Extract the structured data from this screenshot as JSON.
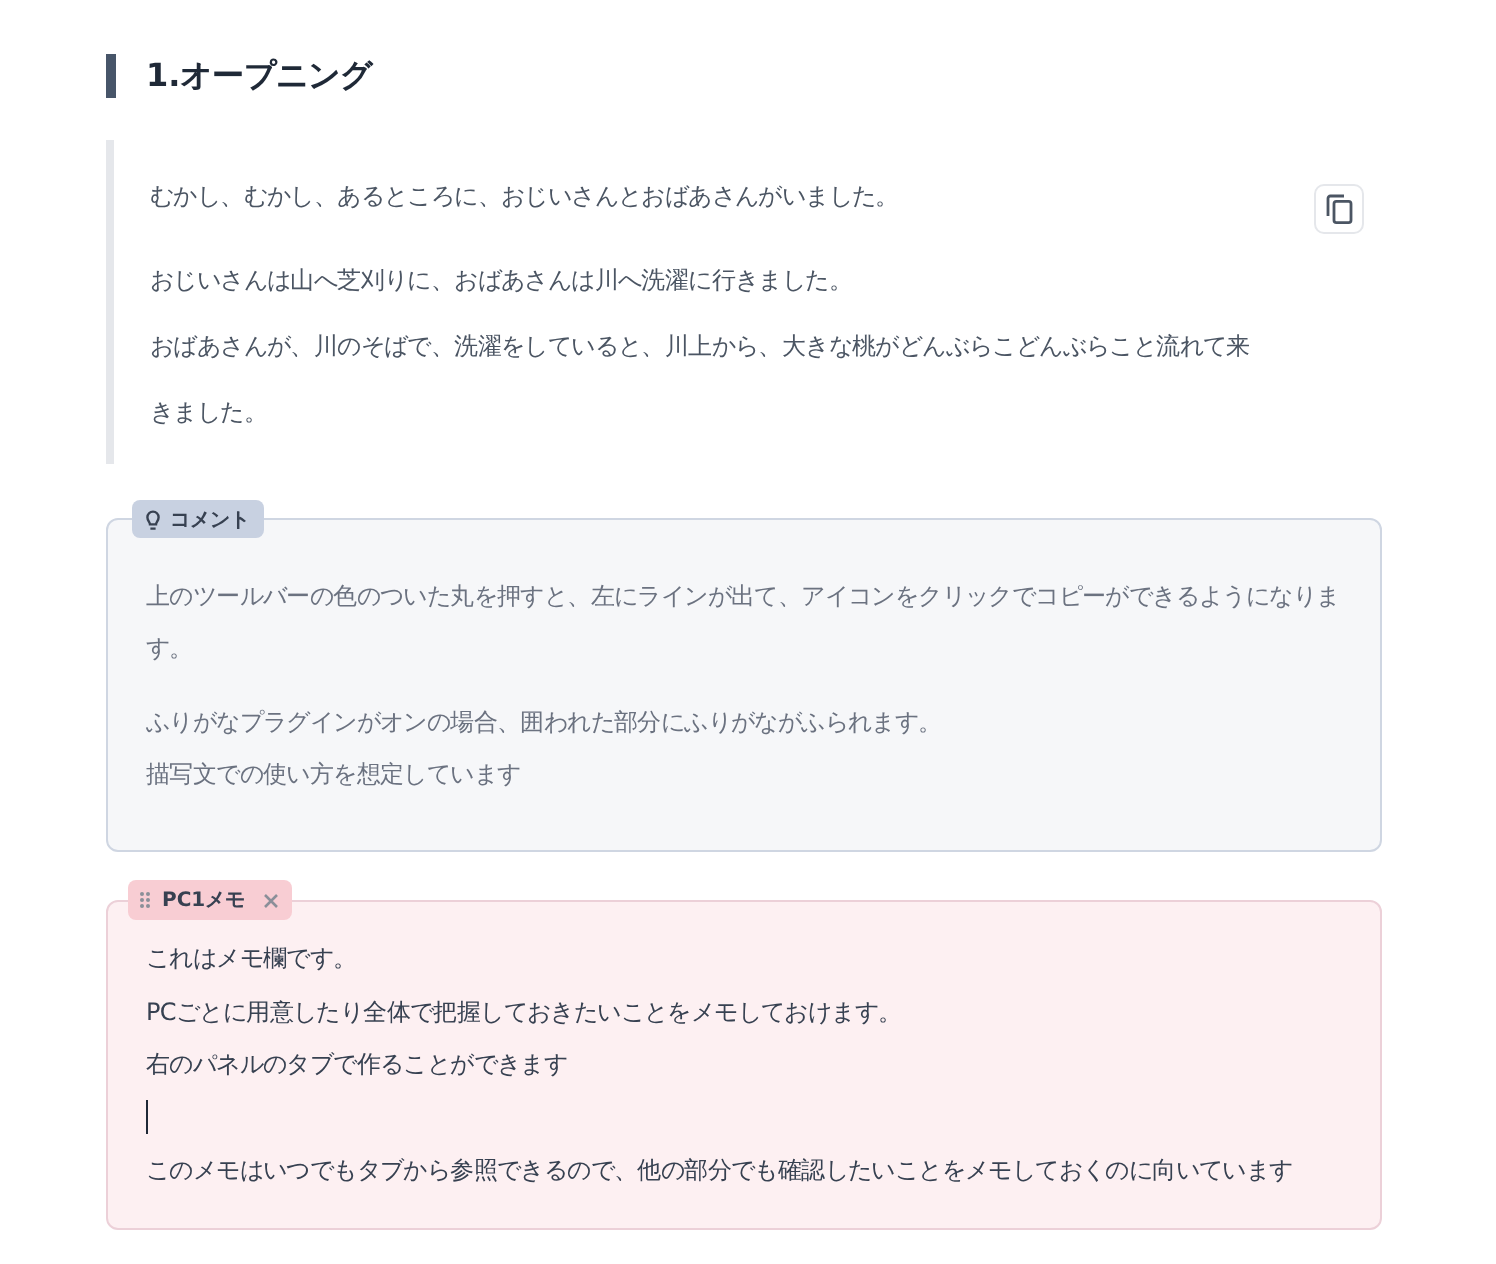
{
  "heading": {
    "title": "1.オープニング"
  },
  "passage": {
    "paragraphs": [
      {
        "lines": [
          "むかし、むかし、あるところに、おじいさんとおばあさんがいました。"
        ]
      },
      {
        "lines": [
          "おじいさんは山へ芝刈りに、おばあさんは川へ洗濯に行きました。",
          "おばあさんが、川のそばで、洗濯をしていると、川上から、大きな桃がどんぶらこどんぶらこと流れて来きました。"
        ]
      }
    ]
  },
  "comment": {
    "tag": "コメント",
    "paragraphs": [
      {
        "lines": [
          "上のツールバーの色のついた丸を押すと、左にラインが出て、アイコンをクリックでコピーができるようになります。"
        ]
      },
      {
        "lines": [
          "ふりがなプラグインがオンの場合、囲われた部分にふりがながふられます。",
          "描写文での使い方を想定しています"
        ]
      }
    ]
  },
  "memo": {
    "tab": {
      "label": "PC1メモ"
    },
    "lines": [
      {
        "kind": "text",
        "text": "これはメモ欄です。"
      },
      {
        "kind": "text",
        "text": "PCごとに用意したり全体で把握しておきたいことをメモしておけます。"
      },
      {
        "kind": "text",
        "text": "右のパネルのタブで作ることができます"
      },
      {
        "kind": "caret"
      },
      {
        "kind": "text",
        "text": "このメモはいつでもタブから参照できるので、他の部分でも確認したいことをメモしておくのに向いています"
      }
    ]
  }
}
